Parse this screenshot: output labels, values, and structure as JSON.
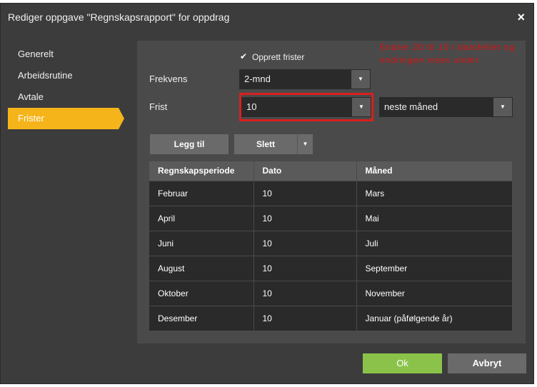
{
  "dialog": {
    "title": "Rediger oppgave \"Regnskapsrapport\" for oppdrag",
    "close_label": "×"
  },
  "nav": [
    {
      "label": "Generelt",
      "active": false
    },
    {
      "label": "Arbeidsrutine",
      "active": false
    },
    {
      "label": "Avtale",
      "active": false
    },
    {
      "label": "Frister",
      "active": true
    }
  ],
  "form": {
    "checkbox_checked": true,
    "checkbox_label": "Opprett frister",
    "frekvens_label": "Frekvens",
    "frekvens_value": "2-mnd",
    "frist_label": "Frist",
    "frist_value": "10",
    "frist_month_value": "neste måned"
  },
  "annotation": "Endrer 20 til 10 i datofeltet og endringen vises under",
  "buttons": {
    "add": "Legg til",
    "delete": "Slett"
  },
  "table": {
    "headers": [
      "Regnskapsperiode",
      "Dato",
      "Måned"
    ],
    "rows": [
      [
        "Februar",
        "10",
        "Mars"
      ],
      [
        "April",
        "10",
        "Mai"
      ],
      [
        "Juni",
        "10",
        "Juli"
      ],
      [
        "August",
        "10",
        "September"
      ],
      [
        "Oktober",
        "10",
        "November"
      ],
      [
        "Desember",
        "10",
        "Januar (påfølgende år)"
      ]
    ]
  },
  "footer": {
    "ok": "Ok",
    "cancel": "Avbryt"
  },
  "colors": {
    "accent": "#f5b41a",
    "ok": "#8bc34a",
    "annotation": "#d91f1f"
  }
}
